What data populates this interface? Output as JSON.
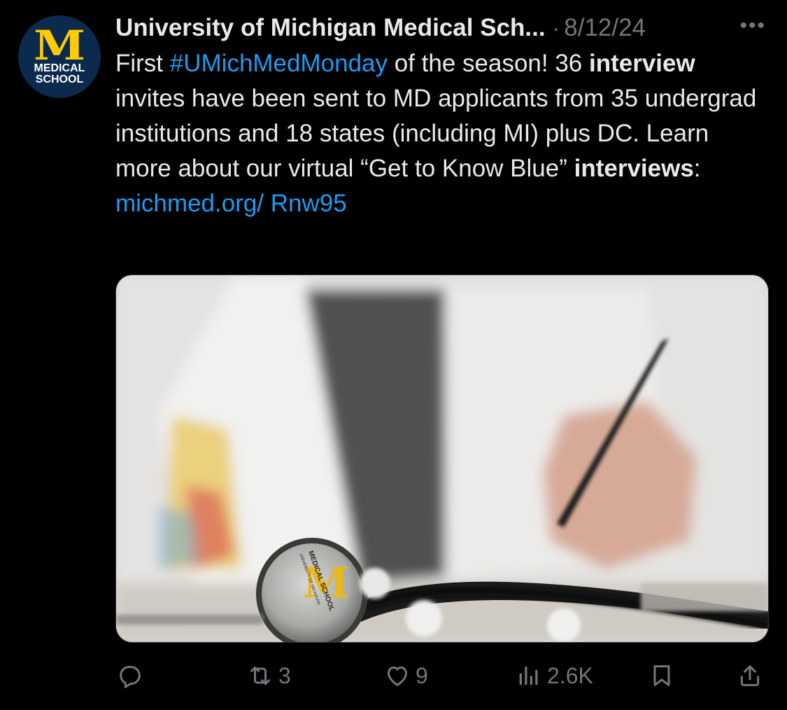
{
  "avatar": {
    "letter": "M",
    "line1": "MEDICAL",
    "line2": "SCHOOL"
  },
  "post": {
    "author": "University of Michigan Medical Sch...",
    "separator": "·",
    "date": "8/12/24",
    "more": "•••",
    "text": {
      "t1": "First ",
      "hashtag": "#UMichMedMonday",
      "t2": " of the season! 36 ",
      "b1": "interview",
      "t3": " invites have been sent to MD applicants from 35 undergrad institutions and 18 states (including MI) plus DC. Learn more about our virtual “Get to Know Blue” ",
      "b2": "interviews",
      "t4": ": ",
      "link": "michmed.org/ Rnw95"
    },
    "image": {
      "stethoscope_line1": "MEDICAL SCHOOL",
      "stethoscope_line2": "UNIVERSITY OF MICHIGAN",
      "letter": "M"
    }
  },
  "actions": {
    "reply": {
      "icon": "reply-icon",
      "count": ""
    },
    "repost": {
      "icon": "repost-icon",
      "count": "3"
    },
    "like": {
      "icon": "heart-icon",
      "count": "9"
    },
    "views": {
      "icon": "views-icon",
      "count": "2.6K"
    },
    "bookmark": {
      "icon": "bookmark-icon"
    },
    "share": {
      "icon": "share-icon"
    }
  },
  "colors": {
    "background": "#000000",
    "text": "#e7e9ea",
    "muted": "#71767b",
    "link": "#1d9bf0",
    "brand_maize": "#ffcb05",
    "brand_blue": "#0b2a4d"
  }
}
